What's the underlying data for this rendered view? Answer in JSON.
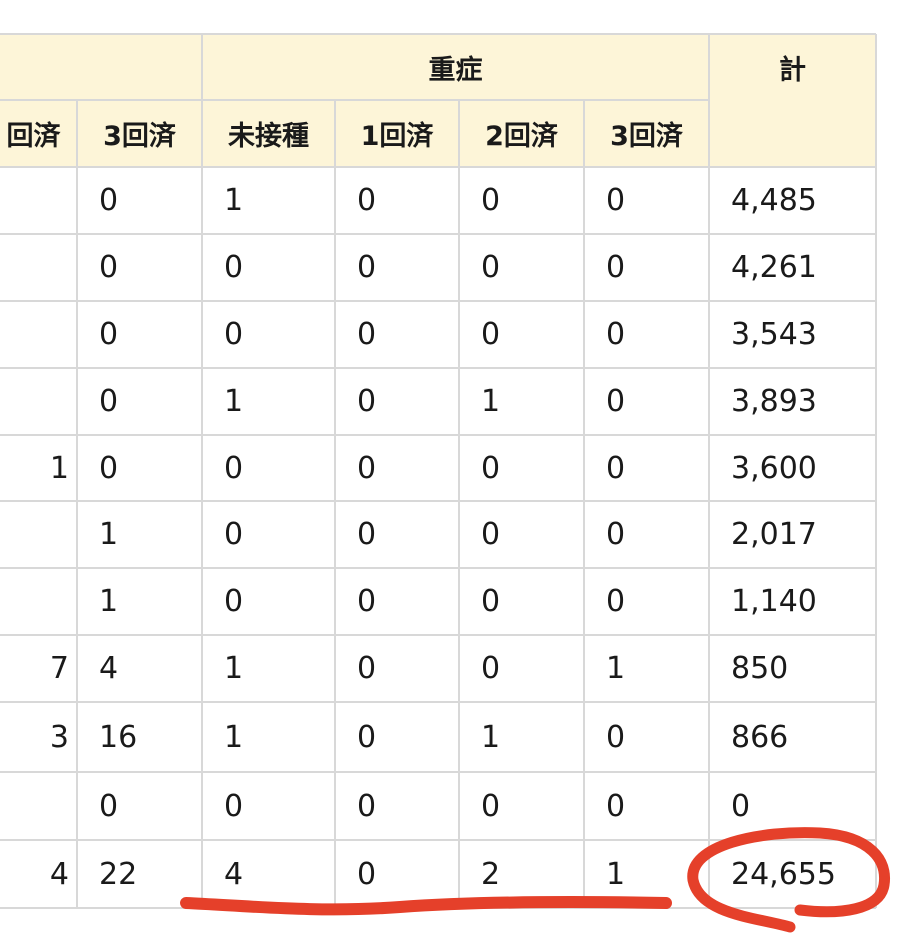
{
  "table": {
    "group_headers": [
      {
        "key": "prev",
        "label": ""
      },
      {
        "key": "severe",
        "label": "重症"
      },
      {
        "key": "total",
        "label": "計"
      }
    ],
    "sub_headers": [
      "回済",
      "3回済",
      "未接種",
      "1回済",
      "2回済",
      "3回済",
      ""
    ],
    "rows": [
      [
        "",
        "0",
        "1",
        "0",
        "0",
        "0",
        "4,485"
      ],
      [
        "",
        "0",
        "0",
        "0",
        "0",
        "0",
        "4,261"
      ],
      [
        "",
        "0",
        "0",
        "0",
        "0",
        "0",
        "3,543"
      ],
      [
        "",
        "0",
        "1",
        "0",
        "1",
        "0",
        "3,893"
      ],
      [
        "1",
        "0",
        "0",
        "0",
        "0",
        "0",
        "3,600"
      ],
      [
        "",
        "1",
        "0",
        "0",
        "0",
        "0",
        "2,017"
      ],
      [
        "",
        "1",
        "0",
        "0",
        "0",
        "0",
        "1,140"
      ],
      [
        "7",
        "4",
        "1",
        "0",
        "0",
        "1",
        "850"
      ],
      [
        "3",
        "16",
        "1",
        "0",
        "1",
        "0",
        "866"
      ],
      [
        "",
        "0",
        "0",
        "0",
        "0",
        "0",
        "0"
      ],
      [
        "4",
        "22",
        "4",
        "0",
        "2",
        "1",
        "24,655"
      ]
    ]
  },
  "annotation": {
    "color": "#e5402a",
    "marks": [
      "underline-severe-totals",
      "circle-grand-total"
    ]
  }
}
